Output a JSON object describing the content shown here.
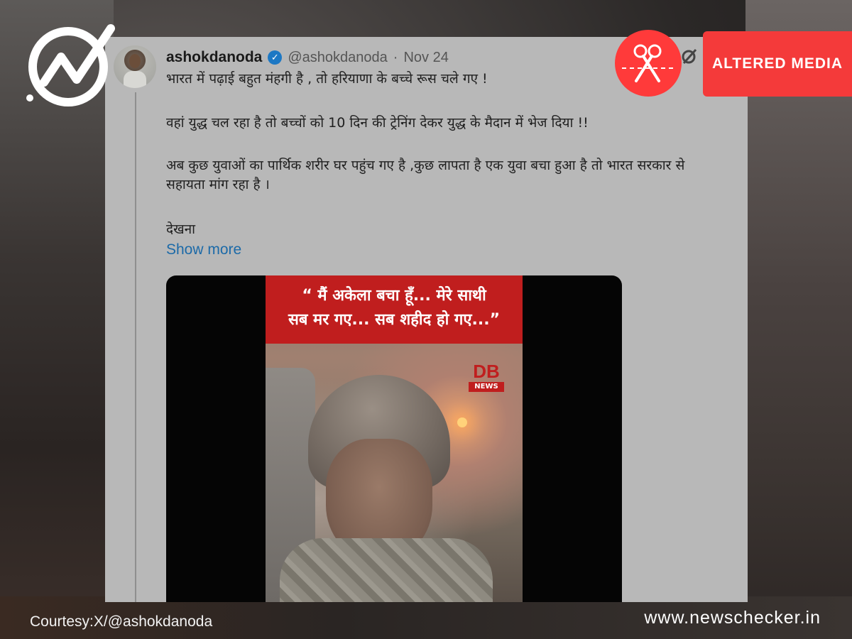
{
  "tweet": {
    "display_name": "ashokdanoda",
    "handle": "@ashokdanoda",
    "separator": "·",
    "date": "Nov 24",
    "lines": [
      "भारत में पढ़ाई बहुत मंहगी है , तो हरियाणा के बच्चे रूस चले गए !",
      "वहां युद्ध चल रहा है तो बच्चों को 10 दिन की  ट्रेनिंग देकर युद्ध के मैदान में भेज दिया !!",
      "अब कुछ युवाओं का पार्थिक शरीर घर पहुंच गए है ,कुछ लापता है एक युवा बचा हुआ है तो भारत सरकार से सहायता मांग रहा है ।",
      "देखना"
    ],
    "show_more": "Show more"
  },
  "video": {
    "caption_line1": "“ मैं अकेला बचा हूँ... मेरे साथी",
    "caption_line2": "सब मर गए... सब शहीद हो गए...”",
    "logo_db": "DB",
    "logo_news": "NEWS"
  },
  "overlay": {
    "badge_label": "ALTERED MEDIA",
    "courtesy": "Courtesy:X/@ashokdanoda",
    "site": "www.newschecker.in"
  },
  "colors": {
    "accent_red": "#f43a3a",
    "link_blue": "#1c6aa8",
    "verified_blue": "#1d78c4"
  }
}
